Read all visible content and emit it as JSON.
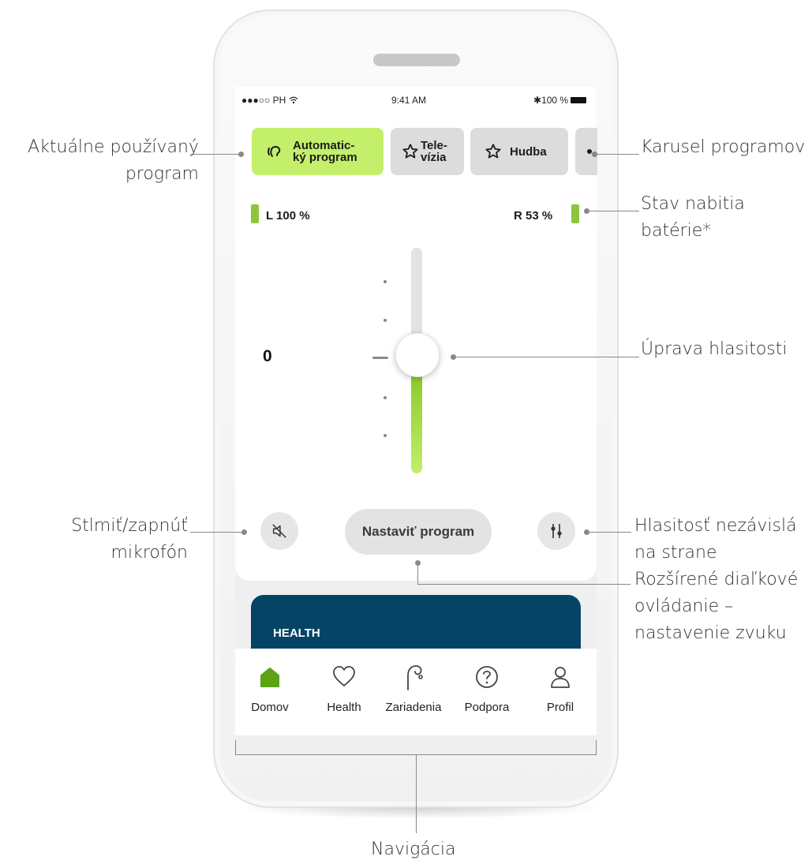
{
  "status_bar": {
    "carrier": "●●●○○ PH",
    "wifi_icon": "wifi-icon",
    "time": "9:41 AM",
    "battery": "100 %"
  },
  "programs": [
    {
      "label_line1": "Automatic-",
      "label_line2": "ký program",
      "icon": "ear-icon",
      "active": true
    },
    {
      "label_line1": "Tele-",
      "label_line2": "vízia",
      "icon": "star-icon",
      "active": false
    },
    {
      "label": "Hudba",
      "icon": "star-icon",
      "active": false
    }
  ],
  "battery": {
    "left_label": "L 100 %",
    "right_label": "R 53 %",
    "left_level": 1.0,
    "right_level": 0.53
  },
  "volume": {
    "value": "0",
    "level": 0.5
  },
  "buttons": {
    "mute_icon": "mic-muted-icon",
    "adjust_program": "Nastaviť program",
    "split_icon": "sliders-icon"
  },
  "health_card": {
    "title": "HEALTH"
  },
  "nav": [
    {
      "label": "Domov",
      "icon": "home-icon",
      "active": true
    },
    {
      "label": "Health",
      "icon": "heart-icon",
      "active": false
    },
    {
      "label": "Zariadenia",
      "icon": "hearing-aid-icon",
      "active": false
    },
    {
      "label": "Podpora",
      "icon": "question-icon",
      "active": false
    },
    {
      "label": "Profil",
      "icon": "person-icon",
      "active": false
    }
  ],
  "annotations": {
    "current_program_1": "Aktuálne používaný",
    "current_program_2": "program",
    "carousel": "Karusel programov",
    "battery_1": "Stav nabitia",
    "battery_2": "batérie*",
    "volume": "Úprava hlasitosti",
    "mute_1": "Stlmiť/zapnúť",
    "mute_2": "mikrofón",
    "split_1": "Hlasitosť nezávislá",
    "split_2": "na strane",
    "remote_1": "Rozšírené diaľkové",
    "remote_2": "ovládanie –",
    "remote_3": "nastavenie zvuku",
    "navigation": "Navigácia"
  },
  "colors": {
    "accent_green": "#c3ef6b",
    "health_blue": "#064466",
    "battery_green": "#8cc63f",
    "nav_active": "#5aa415"
  }
}
